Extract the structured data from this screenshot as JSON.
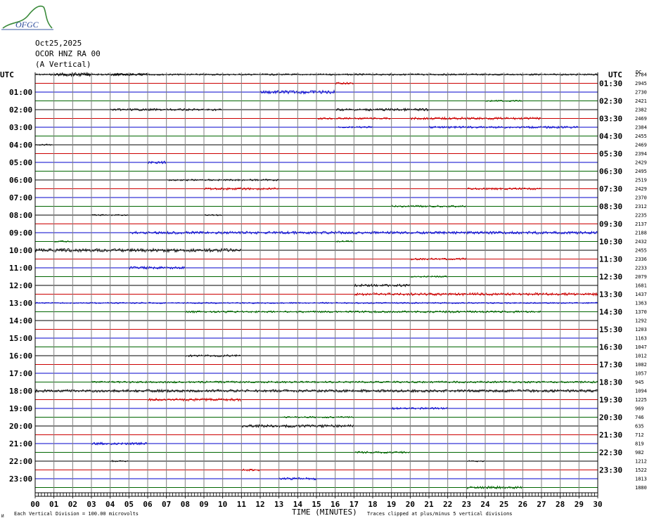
{
  "header": {
    "logo_text": "OFGC",
    "date": "Oct25,2025",
    "station": "OCOR HNZ RA 00",
    "component": "(A Vertical)",
    "utc_left": "UTC",
    "utc_right": "UTC",
    "count_header": "DC"
  },
  "footer": {
    "scale_note": "Each Vertical Division =  100.00 microvolts",
    "clip_note": "Traces clipped at plus/minus 5 vertical divisions",
    "corner_mark": "И"
  },
  "chart_data": {
    "type": "line",
    "title": "",
    "xlabel": "TIME (MINUTES)",
    "xlim": [
      0,
      30
    ],
    "x_ticks": [
      "00",
      "01",
      "02",
      "03",
      "04",
      "05",
      "06",
      "07",
      "08",
      "09",
      "10",
      "11",
      "12",
      "13",
      "14",
      "15",
      "16",
      "17",
      "18",
      "19",
      "20",
      "21",
      "22",
      "23",
      "24",
      "25",
      "26",
      "27",
      "28",
      "29",
      "30"
    ],
    "trace_colors": [
      "#000000",
      "#cc0000",
      "#0000cc",
      "#006600"
    ],
    "grid_line_color": "#808080",
    "left_labels": [
      "01:00",
      "02:00",
      "03:00",
      "04:00",
      "05:00",
      "06:00",
      "07:00",
      "08:00",
      "09:00",
      "10:00",
      "11:00",
      "12:00",
      "13:00",
      "14:00",
      "15:00",
      "16:00",
      "17:00",
      "18:00",
      "19:00",
      "20:00",
      "21:00",
      "22:00",
      "23:00"
    ],
    "right_labels": [
      "01:30",
      "02:30",
      "03:30",
      "04:30",
      "05:30",
      "06:30",
      "07:30",
      "08:30",
      "09:30",
      "10:30",
      "11:30",
      "12:30",
      "13:30",
      "14:30",
      "15:30",
      "16:30",
      "17:30",
      "18:30",
      "19:30",
      "20:30",
      "21:30",
      "22:30",
      "23:30"
    ],
    "trace_counts": [
      2784,
      2945,
      2730,
      2421,
      2382,
      2469,
      2384,
      2455,
      2469,
      2394,
      2429,
      2495,
      2519,
      2429,
      2370,
      2312,
      2235,
      2137,
      2188,
      2432,
      2455,
      2336,
      2233,
      2079,
      1681,
      1437,
      1363,
      1370,
      1292,
      1203,
      1163,
      1047,
      1012,
      1082,
      1057,
      945,
      1094,
      1225,
      969,
      746,
      635,
      712,
      819,
      982,
      1212,
      1522,
      1813,
      1880
    ],
    "activity": [
      [
        [
          0,
          30,
          1.2
        ],
        [
          1,
          3,
          2.5
        ],
        [
          4,
          6,
          1.8
        ]
      ],
      [
        [
          16,
          17,
          1.5
        ]
      ],
      [
        [
          12,
          16,
          2.5
        ]
      ],
      [
        [
          24,
          26,
          1.2
        ]
      ],
      [
        [
          4,
          10,
          1.5
        ],
        [
          16,
          21,
          1.8
        ]
      ],
      [
        [
          15,
          19,
          1.5
        ],
        [
          20,
          27,
          1.8
        ]
      ],
      [
        [
          16,
          18,
          1.2
        ],
        [
          21,
          29,
          1.5
        ]
      ],
      [],
      [
        [
          0,
          1,
          1
        ]
      ],
      [],
      [
        [
          6,
          7,
          2
        ]
      ],
      [],
      [
        [
          7,
          13,
          1.2
        ]
      ],
      [
        [
          9,
          13,
          1.8
        ],
        [
          23,
          27,
          1.5
        ]
      ],
      [],
      [
        [
          19,
          23,
          1.5
        ]
      ],
      [
        [
          3,
          5,
          1
        ],
        [
          9,
          10,
          1.2
        ]
      ],
      [],
      [
        [
          5,
          30,
          2
        ]
      ],
      [
        [
          1,
          2,
          1.2
        ],
        [
          16,
          17,
          1.5
        ]
      ],
      [
        [
          0,
          11,
          2.5
        ]
      ],
      [
        [
          20,
          23,
          1.5
        ]
      ],
      [
        [
          5,
          8,
          1.8
        ]
      ],
      [
        [
          20,
          22,
          1.2
        ]
      ],
      [
        [
          17,
          20,
          1.8
        ]
      ],
      [
        [
          17,
          30,
          2
        ]
      ],
      [
        [
          0,
          30,
          1
        ]
      ],
      [
        [
          8,
          27,
          1.5
        ]
      ],
      [],
      [],
      [],
      [],
      [
        [
          8,
          11,
          1.5
        ]
      ],
      [],
      [],
      [
        [
          3,
          30,
          1.5
        ]
      ],
      [
        [
          0,
          30,
          2
        ]
      ],
      [
        [
          6,
          11,
          2
        ]
      ],
      [
        [
          19,
          22,
          1.5
        ]
      ],
      [
        [
          13,
          17,
          1.2
        ]
      ],
      [
        [
          11,
          17,
          2
        ]
      ],
      [],
      [
        [
          3,
          6,
          1.8
        ]
      ],
      [
        [
          17,
          20,
          1.5
        ]
      ],
      [
        [
          4,
          5,
          1.2
        ],
        [
          23,
          24,
          1
        ]
      ],
      [
        [
          11,
          12,
          1.5
        ]
      ],
      [
        [
          13,
          15,
          1.8
        ]
      ],
      [
        [
          23,
          26,
          2
        ]
      ]
    ]
  }
}
